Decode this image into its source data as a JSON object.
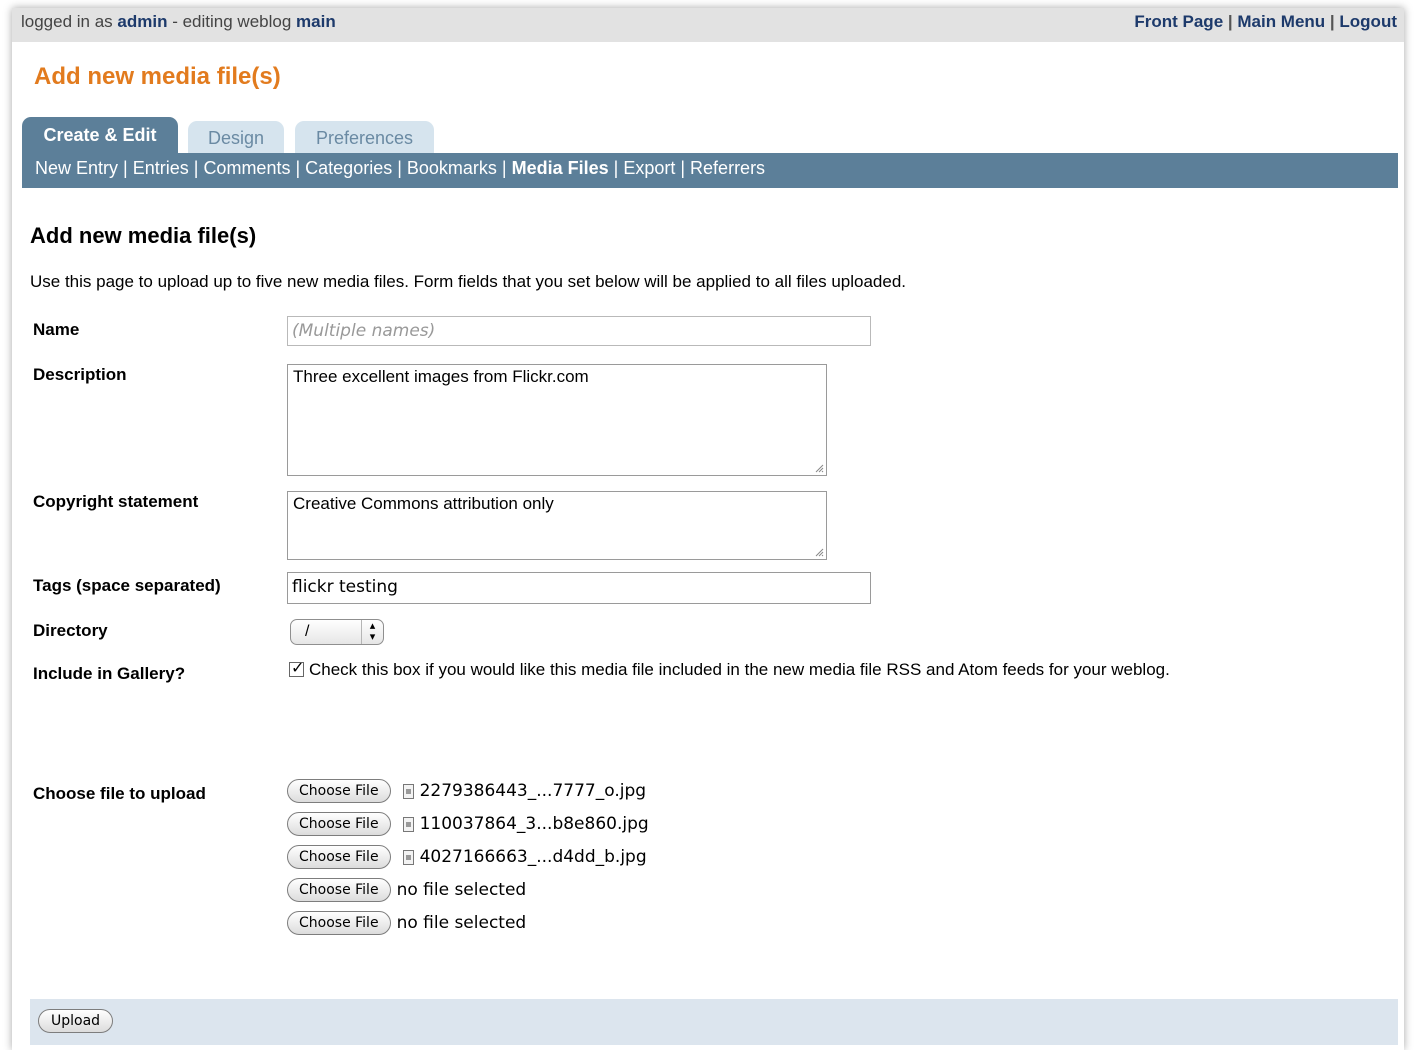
{
  "topbar": {
    "prefix": "logged in as",
    "user": "admin",
    "middle": "- editing weblog",
    "weblog": "main",
    "links": [
      "Front Page",
      "Main Menu",
      "Logout"
    ]
  },
  "page_title": "Add new media file(s)",
  "tabs": [
    {
      "label": "Create & Edit",
      "active": true
    },
    {
      "label": "Design",
      "active": false
    },
    {
      "label": "Preferences",
      "active": false
    }
  ],
  "nav": [
    {
      "label": "New Entry"
    },
    {
      "label": "Entries"
    },
    {
      "label": "Comments"
    },
    {
      "label": "Categories"
    },
    {
      "label": "Bookmarks"
    },
    {
      "label": "Media Files",
      "current": true
    },
    {
      "label": "Export"
    },
    {
      "label": "Referrers"
    }
  ],
  "form": {
    "heading": "Add new media file(s)",
    "intro": "Use this page to upload up to five new media files. Form fields that you set below will be applied to all files uploaded.",
    "name_label": "Name",
    "name_placeholder": "(Multiple names)",
    "description_label": "Description",
    "description_value": "Three excellent images from Flickr.com",
    "copyright_label": "Copyright statement",
    "copyright_value": "Creative Commons attribution only",
    "tags_label": "Tags (space separated)",
    "tags_value": "flickr testing",
    "directory_label": "Directory",
    "directory_value": "/",
    "gallery_label": "Include in Gallery?",
    "gallery_checked": true,
    "gallery_text": "Check this box if you would like this media file included in the new media file RSS and Atom feeds for your weblog.",
    "upload_label": "Choose file to upload",
    "choose_label": "Choose File",
    "files": [
      {
        "name": "2279386443_...7777_o.jpg",
        "selected": true
      },
      {
        "name": "110037864_3...b8e860.jpg",
        "selected": true
      },
      {
        "name": "4027166663_...d4dd_b.jpg",
        "selected": true
      },
      {
        "name": "no file selected",
        "selected": false
      },
      {
        "name": "no file selected",
        "selected": false
      }
    ],
    "submit_label": "Upload"
  }
}
